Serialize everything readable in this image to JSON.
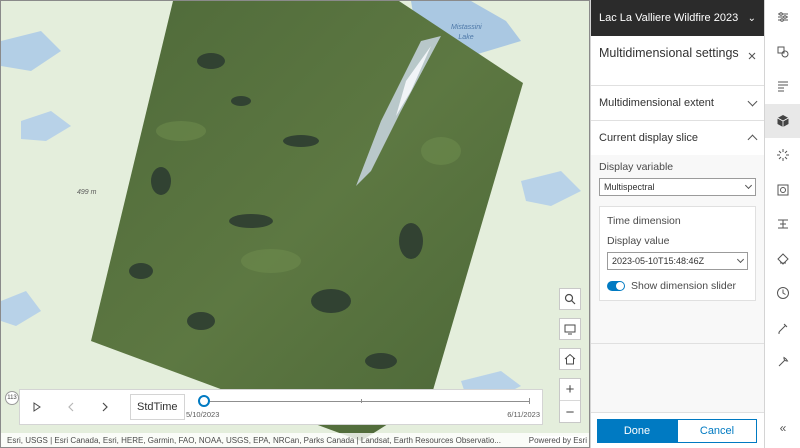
{
  "map": {
    "elevation_label": "499 m",
    "lake_label": "Mistassini Lake",
    "tools": [
      "search-icon",
      "screen-icon",
      "home-icon"
    ],
    "zoom": {
      "in": "+",
      "out": "−"
    },
    "attribution": "Esri, USGS | Esri Canada, Esri, HERE, Garmin, FAO, NOAA, USGS, EPA, NRCan, Parks Canada | Landsat, Earth Resources Observatio...",
    "powered_by": "Powered by Esri",
    "badge": "113"
  },
  "time_slider": {
    "play_icon": "play-icon",
    "prev_icon": "previous-icon",
    "next_icon": "next-icon",
    "mode_label": "StdTime",
    "start_label": "5/10/2023",
    "end_label": "6/11/2023",
    "position_fraction": 0
  },
  "panel": {
    "header_title": "Lac La Valliere Wildfire 2023",
    "settings_title": "Multidimensional settings",
    "extent_label": "Multidimensional extent",
    "slice_label": "Current display slice",
    "display_variable_label": "Display variable",
    "display_variable_value": "Multispectral",
    "time_dimension_label": "Time dimension",
    "display_value_label": "Display value",
    "display_value": "2023-05-10T15:48:46Z",
    "show_slider_label": "Show dimension slider",
    "show_slider_on": true,
    "done_label": "Done",
    "cancel_label": "Cancel"
  },
  "actionbar": {
    "items": [
      "properties-icon",
      "styles-icon",
      "fields-icon",
      "multidimensional-icon",
      "effects-icon",
      "image-display-icon",
      "processing-icon",
      "configure-pop-ups-icon",
      "time-icon",
      "sketch-icon",
      "tools-icon"
    ],
    "active_index": 3,
    "collapse_icon": "collapse-icon"
  },
  "colors": {
    "accent": "#007ac2",
    "header_bg": "#2b2b2b"
  }
}
